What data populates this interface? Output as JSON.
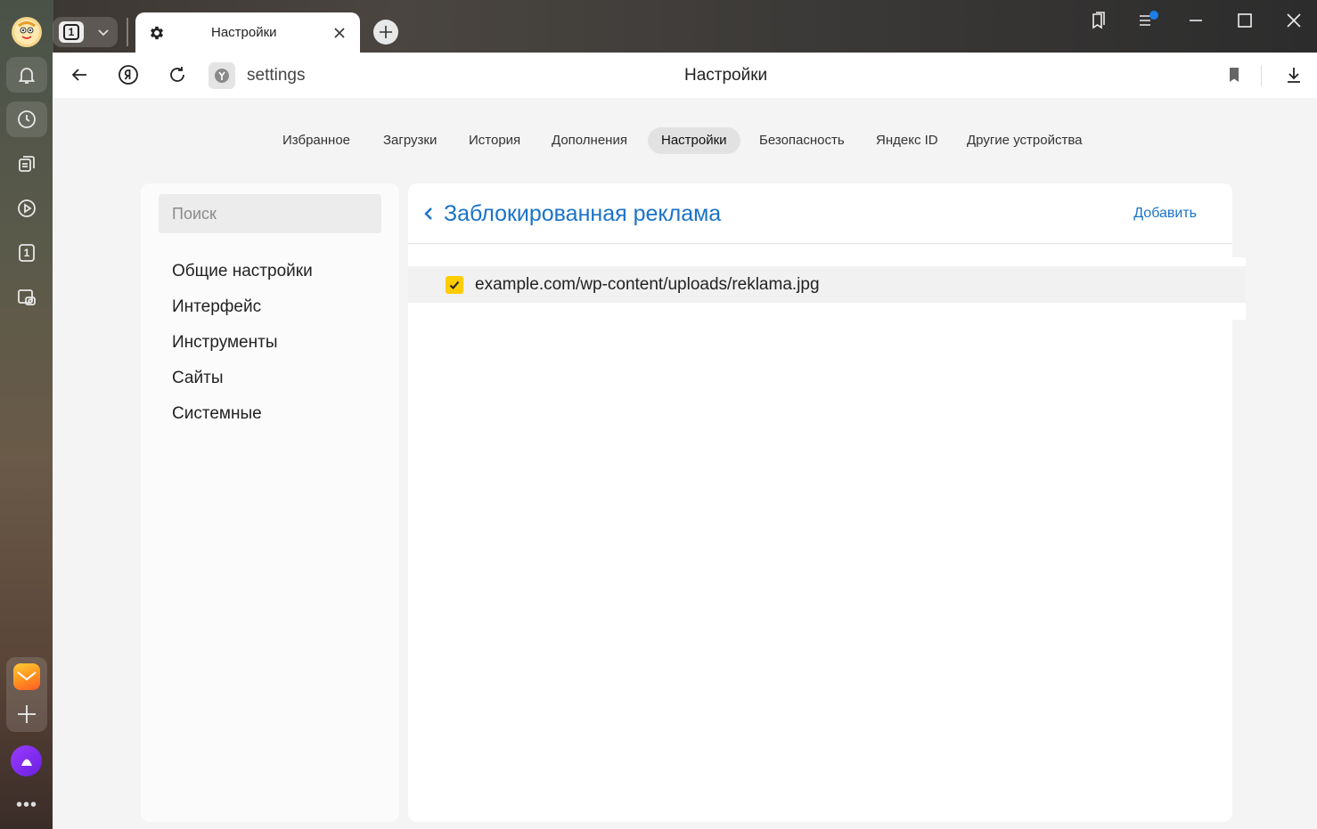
{
  "colors": {
    "accent_link": "#1a73c9",
    "checkbox": "#ffcc00",
    "notification_dot": "#1e7ee8"
  },
  "tab": {
    "title": "Настройки",
    "count": "1"
  },
  "toolbar": {
    "address": "settings",
    "page_title": "Настройки"
  },
  "sidebar": {
    "icons": [
      "bell-icon",
      "history-icon",
      "collections-icon",
      "video-icon",
      "tabs-count-icon",
      "screenshot-icon"
    ],
    "tabs_count": "1"
  },
  "nav": {
    "items": [
      {
        "label": "Избранное"
      },
      {
        "label": "Загрузки"
      },
      {
        "label": "История"
      },
      {
        "label": "Дополнения"
      },
      {
        "label": "Настройки",
        "active": true
      },
      {
        "label": "Безопасность"
      },
      {
        "label": "Яндекс ID"
      },
      {
        "label": "Другие устройства"
      }
    ]
  },
  "menu": {
    "search_placeholder": "Поиск",
    "items": [
      {
        "label": "Общие настройки"
      },
      {
        "label": "Интерфейс"
      },
      {
        "label": "Инструменты"
      },
      {
        "label": "Сайты"
      },
      {
        "label": "Системные"
      }
    ]
  },
  "card": {
    "title": "Заблокированная реклама",
    "add_label": "Добавить",
    "entries": [
      {
        "url": "example.com/wp-content/uploads/reklama.jpg",
        "checked": true
      }
    ]
  }
}
